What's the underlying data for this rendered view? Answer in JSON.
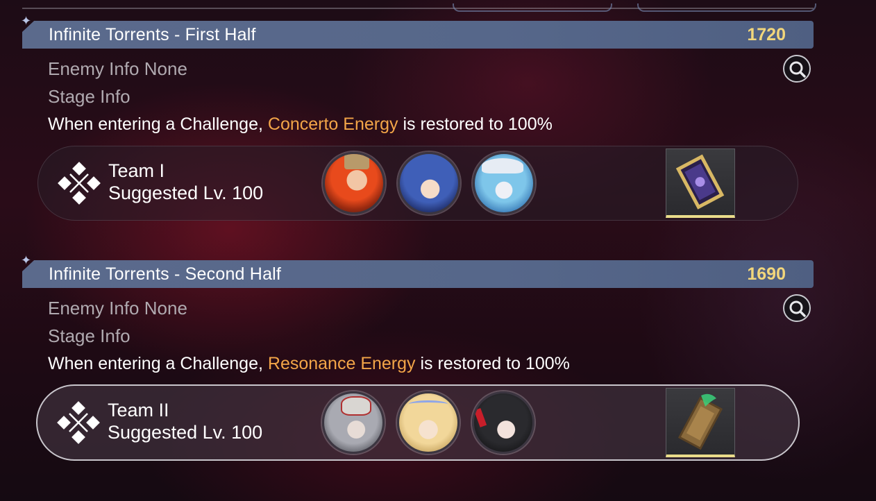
{
  "sections": [
    {
      "title": "Infinite Torrents - First Half",
      "score": "1720",
      "enemy_label": "Enemy Info",
      "enemy_value": "None",
      "stage_label": "Stage Info",
      "desc_prefix": "When entering a Challenge,",
      "desc_highlight": "Concerto Energy",
      "desc_suffix": "is restored to 100%",
      "team": {
        "name": "Team I",
        "level": "Suggested Lv. 100",
        "selected": false,
        "avatars": [
          "red-haired-character",
          "blue-haired-character",
          "white-hat-character"
        ],
        "item": "golden-frame-relic"
      }
    },
    {
      "title": "Infinite Torrents - Second Half",
      "score": "1690",
      "enemy_label": "Enemy Info",
      "enemy_value": "None",
      "stage_label": "Stage Info",
      "desc_prefix": "When entering a Challenge,",
      "desc_highlight": "Resonance Energy",
      "desc_suffix": "is restored to 100%",
      "team": {
        "name": "Team II",
        "level": "Suggested Lv. 100",
        "selected": true,
        "avatars": [
          "masked-silver-character",
          "blonde-crowned-character",
          "black-haired-character"
        ],
        "item": "wooden-case-relic"
      }
    }
  ],
  "colors": {
    "score": "#f2d67b",
    "highlight": "#f3a548",
    "banner": "#56678a",
    "item_bar": "#e9dc8a"
  }
}
